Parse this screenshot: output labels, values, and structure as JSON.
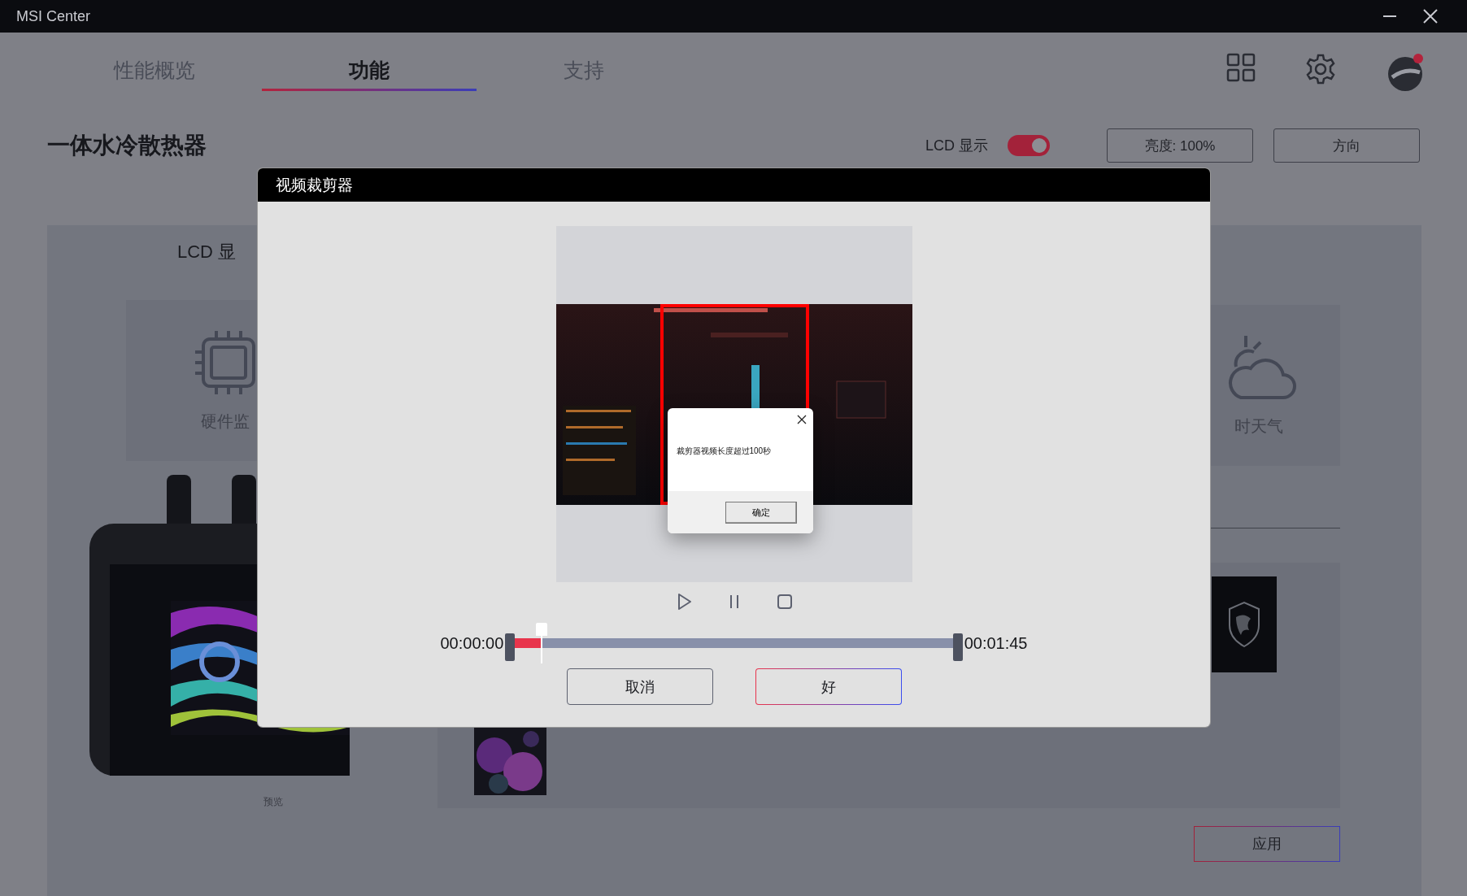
{
  "window": {
    "title": "MSI Center"
  },
  "tabs": [
    {
      "label": "性能概览",
      "selected": false
    },
    {
      "label": "功能",
      "selected": true
    },
    {
      "label": "支持",
      "selected": false
    }
  ],
  "page": {
    "title": "一体水冷散热器",
    "lcd_toggle": {
      "label": "LCD 显示",
      "on": true
    },
    "buttons": [
      "亮度: 100%",
      "方向"
    ]
  },
  "panel": {
    "title": "LCD 显",
    "cards": [
      {
        "label": "硬件监",
        "kind": "hardware"
      },
      {
        "label": "时天气",
        "kind": "weather"
      }
    ],
    "preview_label": "预览",
    "apply": "应用"
  },
  "dialog": {
    "title": "视频裁剪器",
    "start_time": "00:00:00",
    "end_time": "00:01:45",
    "level": 0.06,
    "alert": {
      "message": "裁剪器视频长度超过100秒",
      "button": "确定"
    },
    "buttons": [
      {
        "label": "取消",
        "kind": "secondary"
      },
      {
        "label": "好",
        "kind": "primary"
      }
    ]
  }
}
